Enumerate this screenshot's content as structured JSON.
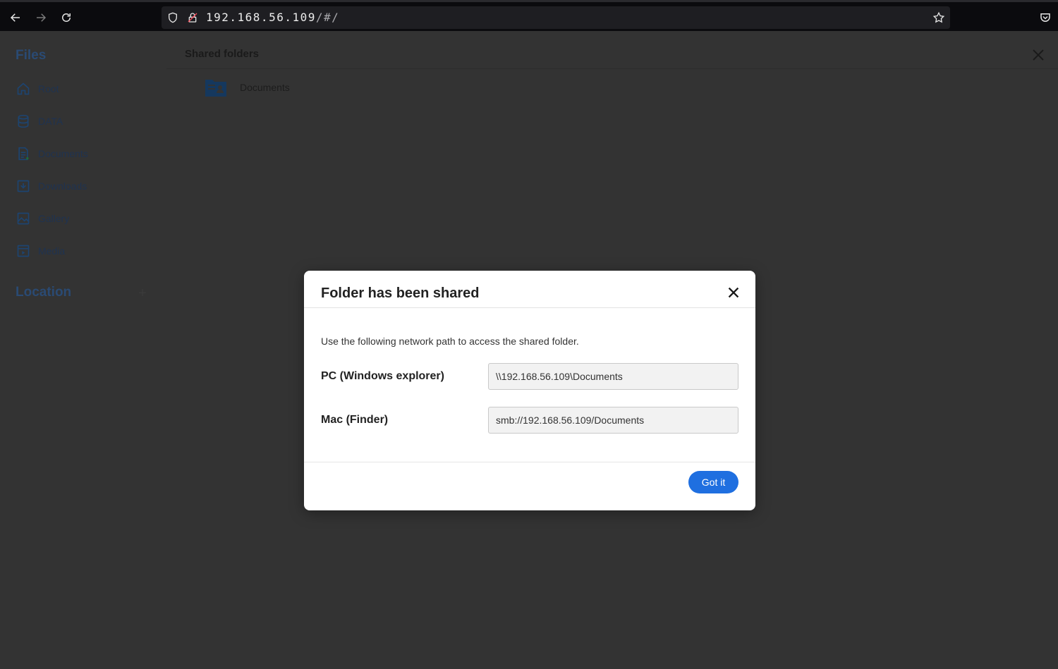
{
  "browser": {
    "url_host": "192.168.56.109",
    "url_path": "/#/"
  },
  "sidebar": {
    "title": "Files",
    "items": [
      {
        "label": "Root",
        "icon": "home-icon"
      },
      {
        "label": "DATA",
        "icon": "database-icon"
      },
      {
        "label": "Documents",
        "icon": "document-icon"
      },
      {
        "label": "Downloads",
        "icon": "download-icon"
      },
      {
        "label": "Gallery",
        "icon": "image-icon"
      },
      {
        "label": "Media",
        "icon": "media-icon"
      }
    ],
    "location_title": "Location",
    "location_add": "+"
  },
  "main": {
    "title": "Shared folders",
    "folders": [
      {
        "label": "Documents",
        "icon": "shared-folder-icon"
      }
    ]
  },
  "dialog": {
    "title": "Folder has been shared",
    "description": "Use the following network path to access the shared folder.",
    "pc_label": "PC (Windows explorer)",
    "pc_value": "\\\\192.168.56.109\\Documents",
    "mac_label": "Mac (Finder)",
    "mac_value": "smb://192.168.56.109/Documents",
    "confirm_label": "Got it"
  },
  "colors": {
    "accent": "#1f6fe0",
    "overlay": "#333333",
    "browser_bar": "#0b0b0e"
  }
}
